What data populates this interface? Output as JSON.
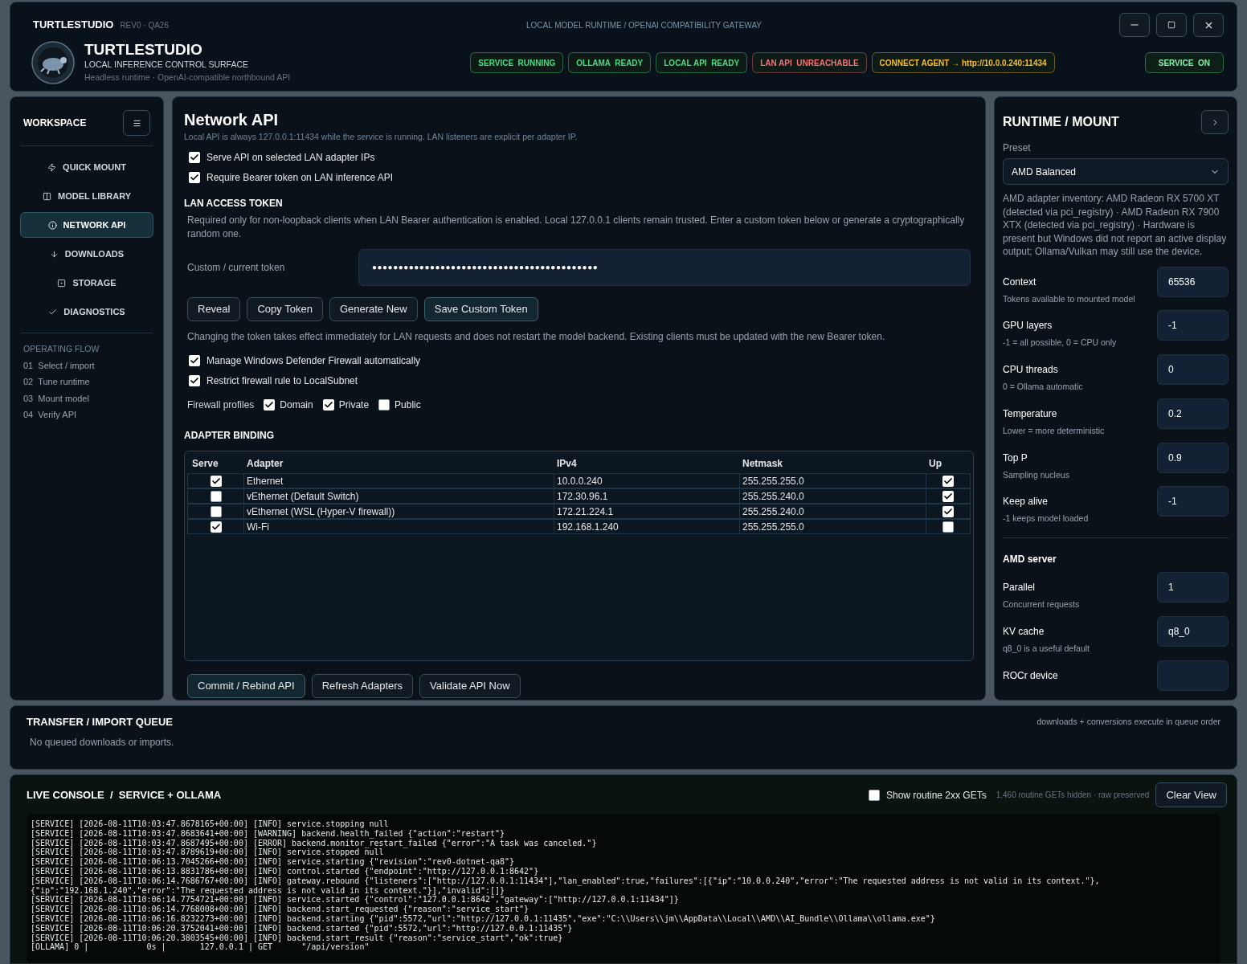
{
  "titlebar": {
    "app": "TURTLESTUDIO",
    "revision": "REV0 · QA26",
    "subtitle": "LOCAL MODEL RUNTIME / OPENAI COMPATIBILITY GATEWAY"
  },
  "brand": {
    "name": "TURTLESTUDIO",
    "tagline": "LOCAL INFERENCE CONTROL SURFACE",
    "description": "Headless runtime · OpenAI-compatible northbound API"
  },
  "status_badges": [
    {
      "label": "SERVICE  RUNNING",
      "color": "#4ade80"
    },
    {
      "label": "OLLAMA  READY",
      "color": "#4ade80"
    },
    {
      "label": "LOCAL API  READY",
      "color": "#4ade80"
    },
    {
      "label": "LAN API  UNREACHABLE",
      "color": "#f87171"
    },
    {
      "label": "CONNECT AGENT → http://10.0.0.240:11434",
      "color": "#fbbf24"
    }
  ],
  "service_toggle": {
    "label": "SERVICE  ON",
    "on": true
  },
  "sidebar": {
    "title": "WORKSPACE",
    "items": [
      {
        "label": "QUICK MOUNT",
        "selected": false
      },
      {
        "label": "MODEL LIBRARY",
        "selected": false
      },
      {
        "label": "NETWORK API",
        "selected": true
      },
      {
        "label": "DOWNLOADS",
        "selected": false
      },
      {
        "label": "STORAGE",
        "selected": false
      },
      {
        "label": "DIAGNOSTICS",
        "selected": false
      }
    ],
    "flow_title": "OPERATING FLOW",
    "flow_steps": [
      {
        "number": "01",
        "label": "Select / import"
      },
      {
        "number": "02",
        "label": "Tune runtime"
      },
      {
        "number": "03",
        "label": "Mount model"
      },
      {
        "number": "04",
        "label": "Verify API"
      }
    ]
  },
  "network_api": {
    "title": "Network API",
    "subtitle": "Local API is always 127.0.0.1:11434 while the service is running. LAN listeners are explicit per adapter IP.",
    "options": [
      {
        "label": "Serve API on selected LAN adapter IPs",
        "checked": true
      },
      {
        "label": "Require Bearer token on LAN inference API",
        "checked": true
      }
    ],
    "token_heading": "LAN ACCESS TOKEN",
    "token_note": "Required only for non-loopback clients when LAN Bearer authentication is enabled. Local 127.0.0.1 clients remain trusted. Enter a custom token below or generate a cryptographically random one.",
    "token_label": "Custom / current token",
    "token_value": "●●●●●●●●●●●●●●●●●●●●●●●●●●●●●●●●●●●●●●●●●●●",
    "token_buttons": [
      "Reveal",
      "Copy Token",
      "Generate New",
      "Save Custom Token"
    ],
    "token_info": "Changing the token takes effect immediately for LAN requests and does not restart the model backend. Existing clients must be updated with the new Bearer token.",
    "firewall_options": [
      {
        "label": "Manage Windows Defender Firewall automatically",
        "checked": true
      },
      {
        "label": "Restrict firewall rule to LocalSubnet",
        "checked": true
      }
    ],
    "profiles_label": "Firewall profiles",
    "profiles": [
      {
        "label": "Domain",
        "checked": true
      },
      {
        "label": "Private",
        "checked": true
      },
      {
        "label": "Public",
        "checked": false
      }
    ],
    "binding_heading": "ADAPTER BINDING",
    "table": {
      "columns": [
        "Serve",
        "Adapter",
        "IPv4",
        "Netmask",
        "Up"
      ],
      "rows": [
        {
          "serve": true,
          "adapter": "Ethernet",
          "ipv4": "10.0.0.240",
          "netmask": "255.255.255.0",
          "up": true
        },
        {
          "serve": false,
          "adapter": "vEthernet (Default Switch)",
          "ipv4": "172.30.96.1",
          "netmask": "255.255.240.0",
          "up": true
        },
        {
          "serve": false,
          "adapter": "vEthernet (WSL (Hyper-V firewall))",
          "ipv4": "172.21.224.1",
          "netmask": "255.255.240.0",
          "up": true
        },
        {
          "serve": true,
          "adapter": "Wi-Fi",
          "ipv4": "192.168.1.240",
          "netmask": "255.255.255.0",
          "up": false
        }
      ]
    },
    "actions": [
      "Commit / Rebind API",
      "Refresh Adapters",
      "Validate API Now"
    ]
  },
  "runtime": {
    "title": "RUNTIME / MOUNT",
    "preset_label": "Preset",
    "preset_value": "AMD Balanced",
    "inventory": "AMD adapter inventory: AMD Radeon RX 5700 XT (detected via pci_registry) · AMD Radeon RX 7900 XTX (detected via pci_registry) · Hardware is present but Windows did not report an active display output; Ollama/Vulkan may still use the device.",
    "items": [
      {
        "kind": "field",
        "label": "Context",
        "value": "65536",
        "hint": "Tokens available to mounted model"
      },
      {
        "kind": "field",
        "label": "GPU layers",
        "value": "-1",
        "hint": "-1 = all possible, 0 = CPU only"
      },
      {
        "kind": "field",
        "label": "CPU threads",
        "value": "0",
        "hint": "0 = Ollama automatic"
      },
      {
        "kind": "field",
        "label": "Temperature",
        "value": "0.2",
        "hint": "Lower = more deterministic"
      },
      {
        "kind": "field",
        "label": "Top P",
        "value": "0.9",
        "hint": "Sampling nucleus"
      },
      {
        "kind": "field",
        "label": "Keep alive",
        "value": "-1",
        "hint": "-1 keeps model loaded"
      },
      {
        "kind": "heading",
        "label": "AMD server"
      },
      {
        "kind": "field",
        "label": "Parallel",
        "value": "1",
        "hint": "Concurrent requests"
      },
      {
        "kind": "field",
        "label": "KV cache",
        "value": "q8_0",
        "hint": "q8_0 is a useful default"
      },
      {
        "kind": "field",
        "label": "ROCr device"
      }
    ]
  },
  "transfer": {
    "title": "TRANSFER / IMPORT QUEUE",
    "note": "downloads + conversions execute in queue order",
    "empty": "No queued downloads or imports."
  },
  "console": {
    "title": "LIVE CONSOLE  /  SERVICE + OLLAMA",
    "filter": {
      "label": "Show routine 2xx GETs",
      "checked": false
    },
    "hidden_note": "1,460 routine GETs hidden · raw preserved",
    "clear_button": "Clear View",
    "lines": [
      "[SERVICE] [2026-08-11T10:03:47.8678165+00:00] [INFO] service.stopping null",
      "[SERVICE] [2026-08-11T10:03:47.8683641+00:00] [WARNING] backend.health_failed {\"action\":\"restart\"}",
      "[SERVICE] [2026-08-11T10:03:47.8687495+00:00] [ERROR] backend.monitor_restart_failed {\"error\":\"A task was canceled.\"}",
      "[SERVICE] [2026-08-11T10:03:47.8789619+00:00] [INFO] service.stopped null",
      "[SERVICE] [2026-08-11T10:06:13.7045266+00:00] [INFO] service.starting {\"revision\":\"rev0-dotnet-qa8\"}",
      "[SERVICE] [2026-08-11T10:06:13.8831786+00:00] [INFO] control.started {\"endpoint\":\"http://127.0.0.1:8642\"}",
      "[SERVICE] [2026-08-11T10:06:14.7686767+00:00] [INFO] gateway.rebound {\"listeners\":[\"http://127.0.0.1:11434\"],\"lan_enabled\":true,\"failures\":[{\"ip\":\"10.0.0.240\",\"error\":\"The requested address is not valid in its context.\"},",
      "{\"ip\":\"192.168.1.240\",\"error\":\"The requested address is not valid in its context.\"}],\"invalid\":[]}",
      "[SERVICE] [2026-08-11T10:06:14.7754721+00:00] [INFO] service.started {\"control\":\"127.0.0.1:8642\",\"gateway\":[\"http://127.0.0.1:11434\"]}",
      "[SERVICE] [2026-08-11T10:06:14.7768008+00:00] [INFO] backend.start_requested {\"reason\":\"service_start\"}",
      "[SERVICE] [2026-08-11T10:06:16.8232273+00:00] [INFO] backend.starting {\"pid\":5572,\"url\":\"http://127.0.0.1:11435\",\"exe\":\"C:\\\\Users\\\\jm\\\\AppData\\\\Local\\\\AMD\\\\AI_Bundle\\\\Ollama\\\\ollama.exe\"}",
      "[SERVICE] [2026-08-11T10:06:20.3752041+00:00] [INFO] backend.started {\"pid\":5572,\"url\":\"http://127.0.0.1:11435\"}",
      "[SERVICE] [2026-08-11T10:06:20.3803545+00:00] [INFO] backend.start_result {\"reason\":\"service_start\",\"ok\":true}",
      "[OLLAMA] 0 |            0s |       127.0.0.1 | GET      \"/api/version\""
    ]
  }
}
